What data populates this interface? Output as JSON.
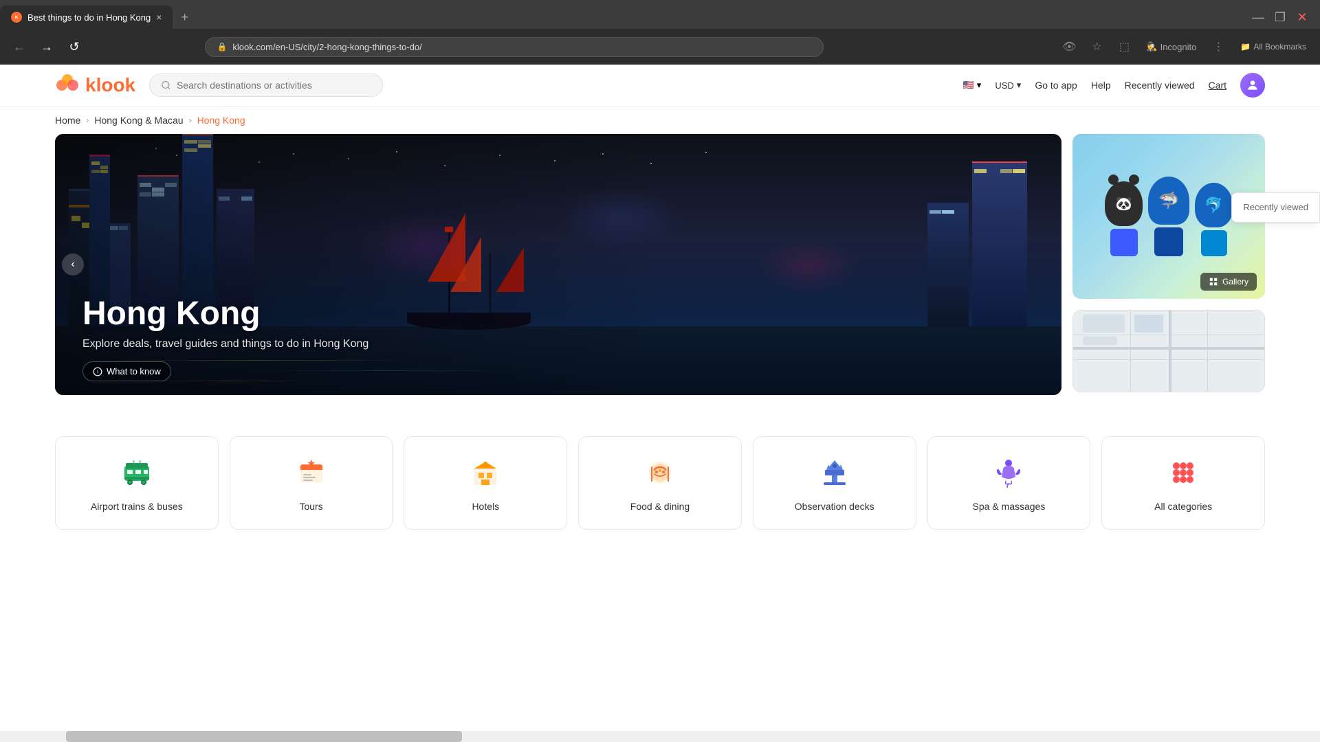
{
  "browser": {
    "tab": {
      "title": "Best things to do in Hong Kong",
      "favicon": "K",
      "close_icon": "×",
      "new_tab_icon": "+"
    },
    "controls": {
      "minimize": "—",
      "maximize": "❐",
      "close": "✕"
    },
    "nav": {
      "back_icon": "←",
      "forward_icon": "→",
      "refresh_icon": "↺",
      "url": "klook.com/en-US/city/2-hong-kong-things-to-do/",
      "star_icon": "☆",
      "lock_icon": "🔒"
    },
    "toolbar_right": {
      "incognito_icon": "🕵",
      "incognito_label": "Incognito",
      "bookmarks_icon": "📁",
      "bookmarks_label": "All Bookmarks"
    }
  },
  "nav": {
    "logo_text": "klook",
    "search_placeholder": "Search destinations or activities",
    "flag": "🇺🇸",
    "currency": "USD",
    "currency_arrow": "▾",
    "flag_arrow": "▾",
    "go_to_app": "Go to app",
    "help": "Help",
    "recently_viewed": "Recently viewed",
    "cart": "Cart"
  },
  "breadcrumb": {
    "home": "Home",
    "region": "Hong Kong & Macau",
    "current": "Hong Kong",
    "sep1": "›",
    "sep2": "›"
  },
  "hero": {
    "city_name": "Hong Kong",
    "subtitle": "Explore deals, travel guides and things to do in Hong Kong",
    "what_to_know": "What to know",
    "nav_left": "‹",
    "gallery_btn": "Gallery"
  },
  "recently_viewed": {
    "label": "Recently viewed"
  },
  "categories": [
    {
      "id": "airport-trains",
      "label": "Airport trains & buses",
      "icon": "bus",
      "color": "#26b665"
    },
    {
      "id": "tours",
      "label": "Tours",
      "icon": "tours",
      "color": "#ff6b35"
    },
    {
      "id": "hotels",
      "label": "Hotels",
      "icon": "hotels",
      "color": "#ff9800"
    },
    {
      "id": "food-dining",
      "label": "Food & dining",
      "icon": "food",
      "color": "#ff6b35"
    },
    {
      "id": "observation-decks",
      "label": "Observation decks",
      "icon": "observation",
      "color": "#5b7fde"
    },
    {
      "id": "spa-massages",
      "label": "Spa & massages",
      "icon": "spa",
      "color": "#7c4dff"
    },
    {
      "id": "all-categories",
      "label": "All categories",
      "icon": "all",
      "color": "#ff5252"
    }
  ]
}
